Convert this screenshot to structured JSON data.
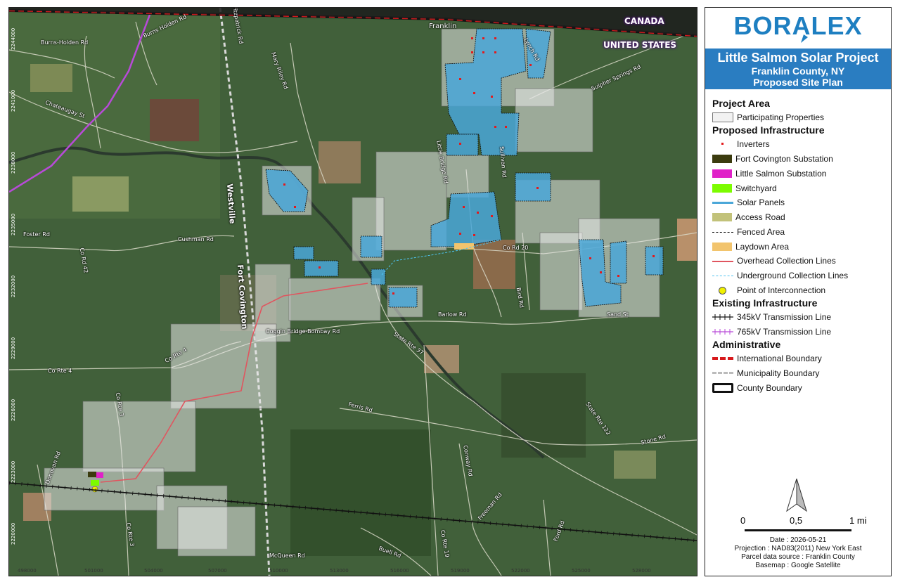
{
  "map": {
    "x_ticks": [
      "498000",
      "501000",
      "504000",
      "507000",
      "510000",
      "513000",
      "516000",
      "519000",
      "522000",
      "525000",
      "528000"
    ],
    "y_ticks": [
      "2244000",
      "2241000",
      "2238000",
      "2235000",
      "2232000",
      "2229000",
      "2226000",
      "2223000",
      "2220000"
    ],
    "country_north": "CANADA",
    "country_south": "UNITED STATES",
    "municipalities": {
      "westville": "Westville",
      "fort_covington": "Fort Covington"
    },
    "place": "Franklin",
    "roads": [
      "Burns Holden Rd",
      "Burns-Holden Rd",
      "Chateaugay St",
      "Foster Rd",
      "Co Rd 42",
      "Cushman Rd",
      "Co Rte 4",
      "Co Rte 4",
      "Co Rte 3",
      "Co Rte 3",
      "Donovan Rd",
      "Fitzpatrick Rd",
      "Mary Riley Rd",
      "Sulpher Springs Rd",
      "Little Bridge Rd",
      "Sullivan Rd",
      "Co Rd 20",
      "Barlow Rd",
      "Bird Rd",
      "Sand St",
      "Coggin Bridge-Bombay Rd",
      "State Rte 37",
      "Ferris Rd",
      "State Rte 122",
      "Stone Rd",
      "Conway Rd",
      "Freeman Rd",
      "Ford Rd",
      "Buell Rd",
      "Co Rte 19",
      "McQueen Rd",
      "Lynch Rd"
    ]
  },
  "panel": {
    "logo": "BORALEX",
    "title": "Little Salmon Solar Project",
    "subtitle1": "Franklin County, NY",
    "subtitle2": "Proposed Site Plan",
    "sections": {
      "project_area": "Project Area",
      "proposed": "Proposed Infrastructure",
      "existing": "Existing Infrastructure",
      "admin": "Administrative"
    },
    "legend": {
      "participating": "Participating Properties",
      "inverters": "Inverters",
      "fort_covington_sub": "Fort Covington Substation",
      "little_salmon_sub": "Little Salmon Substation",
      "switchyard": "Switchyard",
      "solar": "Solar Panels",
      "access": "Access Road",
      "fenced": "Fenced Area",
      "laydown": "Laydown Area",
      "overhead": "Overhead Collection Lines",
      "underground": "Underground Collection Lines",
      "poi": "Point of Interconnection",
      "tx345": "345kV Transmission Line",
      "tx765": "765kV Transmission Line",
      "intl": "International Boundary",
      "muni": "Municipality Boundary",
      "county": "County Boundary"
    },
    "scale": {
      "s0": "0",
      "s1": "0,5",
      "s2": "1 mi"
    },
    "footer": {
      "date": "Date : 2026-05-21",
      "projection": "Projection : NAD83(2011) New York East",
      "parcel": "Parcel data source : Franklin County",
      "basemap": "Basemap : Google Satellite"
    },
    "colors": {
      "solar": "#4aa7d8",
      "inverter": "#e31a1c",
      "fort_sub": "#3b3b0e",
      "ls_sub": "#e021c8",
      "switchyard": "#7cfc00",
      "access": "#c2c27a",
      "laydown": "#f2c46d",
      "overhead": "#e0555f",
      "underground": "#4ec3f0",
      "poi": "#f0f000",
      "intl": "#d7191c",
      "title_bg": "#2a7dc1",
      "logo": "#1e7fc1"
    }
  }
}
